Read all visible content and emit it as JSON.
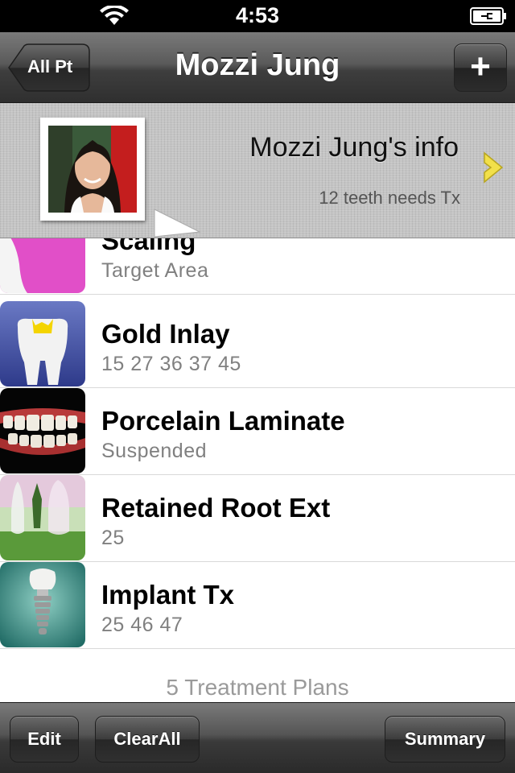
{
  "status_bar": {
    "time": "4:53"
  },
  "nav": {
    "back_label": "All Pt",
    "title": "Mozzi Jung",
    "add_label": "+"
  },
  "patient": {
    "info_title": "Mozzi Jung's info",
    "subtitle": "12 teeth needs Tx"
  },
  "treatments": [
    {
      "title": "Scaling",
      "detail": "Target Area"
    },
    {
      "title": "Gold Inlay",
      "detail": "15 27 36 37 45"
    },
    {
      "title": "Porcelain Laminate",
      "detail": "Suspended"
    },
    {
      "title": "Retained Root Ext",
      "detail": "25"
    },
    {
      "title": "Implant Tx",
      "detail": "25 46 47"
    }
  ],
  "list_footer": "5 Treatment Plans",
  "toolbar": {
    "edit_label": "Edit",
    "clear_label": "ClearAll",
    "summary_label": "Summary"
  },
  "colors": {
    "nav_bar": "#4a4a4a",
    "header_linen": "#c4c4c4",
    "disclosure_accent": "#f2e04a",
    "detail_text": "#808080"
  }
}
